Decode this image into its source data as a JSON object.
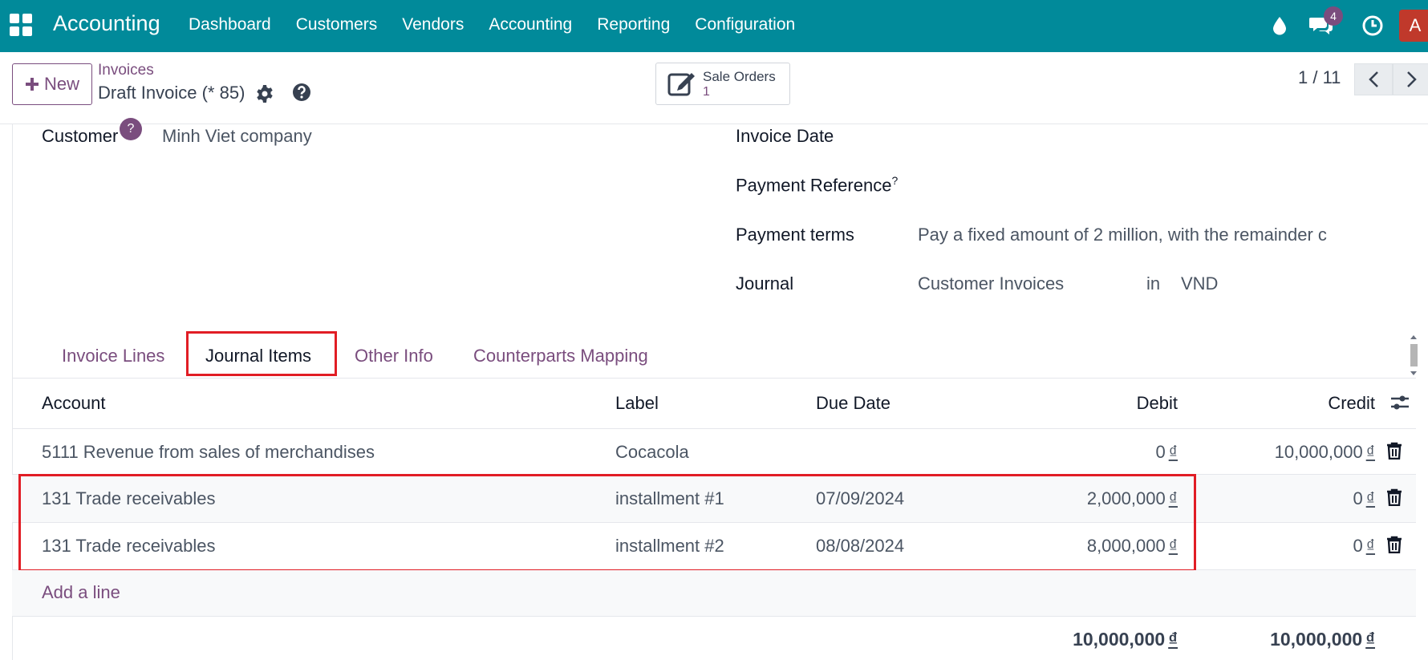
{
  "app": {
    "name": "Accounting",
    "menu": [
      "Dashboard",
      "Customers",
      "Vendors",
      "Accounting",
      "Reporting",
      "Configuration"
    ],
    "messages_badge": "4",
    "avatar_letter": "A",
    "theme_color": "#018a9a",
    "accent_color": "#7a4d7e"
  },
  "control": {
    "new_label": "New",
    "breadcrumb": "Invoices",
    "record_title": "Draft Invoice (* 85)",
    "smart_button": {
      "label": "Sale Orders",
      "count": "1"
    },
    "pager": "1 / 11"
  },
  "form": {
    "customer_label": "Customer",
    "customer_help": "?",
    "customer_value": "Minh Viet company",
    "invoice_date_label": "Invoice Date",
    "payment_reference_label": "Payment Reference",
    "payment_reference_help": "?",
    "payment_terms_label": "Payment terms",
    "payment_terms_value": "Pay a fixed amount of 2 million, with the remainder c",
    "journal_label": "Journal",
    "journal_value": "Customer Invoices",
    "journal_in": "in",
    "journal_currency": "VND"
  },
  "tabs": [
    "Invoice Lines",
    "Journal Items",
    "Other Info",
    "Counterparts Mapping"
  ],
  "table": {
    "headers": {
      "account": "Account",
      "label": "Label",
      "due_date": "Due Date",
      "debit": "Debit",
      "credit": "Credit"
    },
    "currency_symbol": "₫",
    "rows": [
      {
        "account": "5111 Revenue from sales of merchandises",
        "label": "Cocacola",
        "due_date": "",
        "debit": "0",
        "credit": "10,000,000"
      },
      {
        "account": "131 Trade receivables",
        "label": "installment #1",
        "due_date": "07/09/2024",
        "debit": "2,000,000",
        "credit": "0"
      },
      {
        "account": "131 Trade receivables",
        "label": "installment #2",
        "due_date": "08/08/2024",
        "debit": "8,000,000",
        "credit": "0"
      }
    ],
    "add_line": "Add a line",
    "total_debit": "10,000,000",
    "total_credit": "10,000,000"
  }
}
